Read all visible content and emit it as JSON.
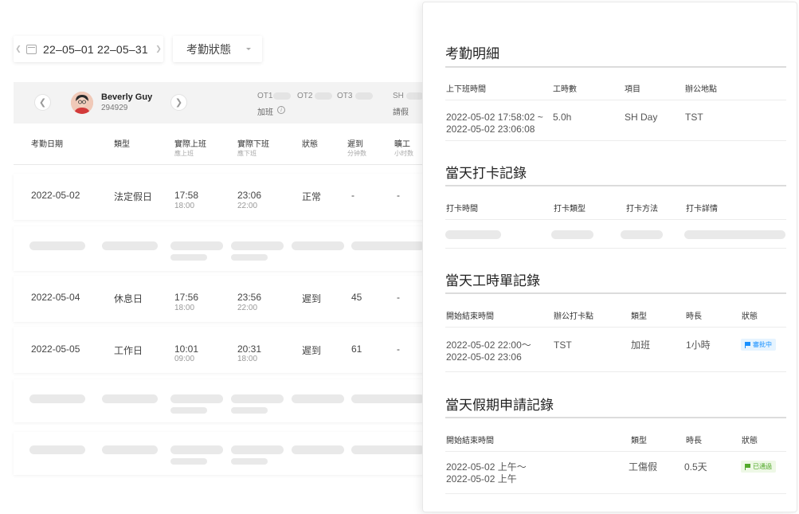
{
  "filters": {
    "date_range": "22–05–01 22–05–31",
    "status_select": "考勤狀態"
  },
  "employee": {
    "name": "Beverly Guy",
    "id": "294929",
    "ot_labels": [
      "OT1",
      "OT2",
      "OT3"
    ],
    "overtime_label": "加班",
    "sh_label": "SH",
    "leave_label": "請假"
  },
  "table": {
    "headers": [
      {
        "label": "考勤日期",
        "sub": ""
      },
      {
        "label": "類型",
        "sub": ""
      },
      {
        "label": "實際上班",
        "sub": "應上班"
      },
      {
        "label": "實際下班",
        "sub": "應下班"
      },
      {
        "label": "狀態",
        "sub": ""
      },
      {
        "label": "遲到",
        "sub": "分钟数"
      },
      {
        "label": "曠工",
        "sub": "小时数"
      }
    ],
    "rows": [
      {
        "date": "2022-05-02",
        "type": "法定假日",
        "in": "17:58",
        "in_sched": "18:00",
        "out": "23:06",
        "out_sched": "22:00",
        "status": "正常",
        "late": "-",
        "absent": "-"
      },
      {
        "date": "2022-05-04",
        "type": "休息日",
        "in": "17:56",
        "in_sched": "18:00",
        "out": "23:56",
        "out_sched": "22:00",
        "status": "遲到",
        "late": "45",
        "absent": "-"
      },
      {
        "date": "2022-05-05",
        "type": "工作日",
        "in": "10:01",
        "in_sched": "09:00",
        "out": "20:31",
        "out_sched": "18:00",
        "status": "遲到",
        "late": "61",
        "absent": "-"
      }
    ]
  },
  "panel": {
    "detail": {
      "title": "考勤明細",
      "headers": [
        "上下班時間",
        "工時數",
        "項目",
        "辦公地點"
      ],
      "row": {
        "time_line1": "2022-05-02 17:58:02 ~",
        "time_line2": "2022-05-02  23:06:08",
        "hours": "5.0h",
        "item": "SH Day",
        "location": "TST"
      }
    },
    "punch": {
      "title": "當天打卡記錄",
      "headers": [
        "打卡時間",
        "打卡類型",
        "打卡方法",
        "打卡詳情"
      ]
    },
    "timesheet": {
      "title": "當天工時單記錄",
      "headers": [
        "開始結束時間",
        "辦公打卡點",
        "類型",
        "時長",
        "狀態"
      ],
      "row": {
        "time_line1": "2022-05-02 22:00～",
        "time_line2": "2022-05-02 23:06",
        "location": "TST",
        "type": "加班",
        "duration": "1小時",
        "status": "審批中"
      }
    },
    "leave": {
      "title": "當天假期申請記錄",
      "headers": [
        "開始結束時間",
        "類型",
        "時長",
        "狀態"
      ],
      "row": {
        "time_line1": "2022-05-02  上午～",
        "time_line2": "2022-05-02  上午",
        "type": "工傷假",
        "duration": "0.5天",
        "status": "已通過"
      }
    }
  },
  "colors": {
    "pending_text": "#1890ff",
    "pending_bg": "#e6f4ff",
    "approved_text": "#52a92a",
    "approved_bg": "#eef8e6",
    "skeleton": "#e9e9e9"
  }
}
